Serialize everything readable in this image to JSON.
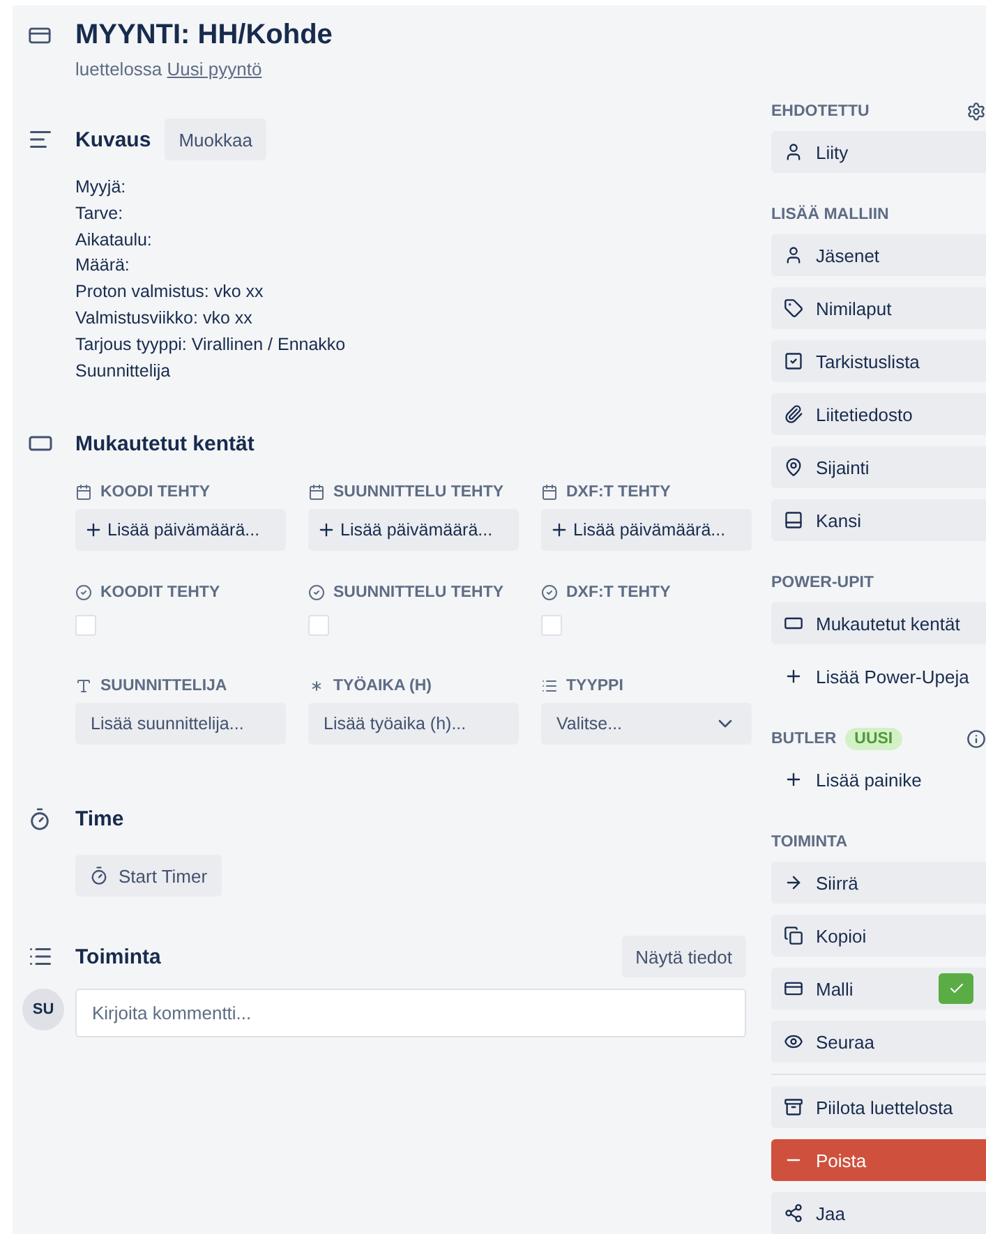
{
  "card": {
    "title": "MYYNTI: HH/Kohde",
    "list_prefix": "luettelossa",
    "list_link": "Uusi pyyntö"
  },
  "description": {
    "heading": "Kuvaus",
    "edit_button": "Muokkaa",
    "lines": [
      "Myyjä:",
      "Tarve:",
      "Aikataulu:",
      "Määrä:",
      "Proton valmistus: vko xx",
      "Valmistusviikko: vko xx",
      "Tarjous tyyppi: Virallinen / Ennakko",
      "Suunnittelija"
    ]
  },
  "custom_fields": {
    "heading": "Mukautetut kentät",
    "fields": [
      {
        "kind": "date",
        "label": "KOODI TEHTY",
        "action": "Lisää päivämäärä..."
      },
      {
        "kind": "date",
        "label": "SUUNNITTELU TEHTY",
        "action": "Lisää päivämäärä..."
      },
      {
        "kind": "date",
        "label": "DXF:T TEHTY",
        "action": "Lisää päivämäärä..."
      },
      {
        "kind": "checkbox",
        "label": "KOODIT TEHTY",
        "checked": false
      },
      {
        "kind": "checkbox",
        "label": "SUUNNITTELU TEHTY",
        "checked": false
      },
      {
        "kind": "checkbox",
        "label": "DXF:T TEHTY",
        "checked": false
      },
      {
        "kind": "text",
        "label": "SUUNNITTELIJA",
        "placeholder": "Lisää suunnittelija..."
      },
      {
        "kind": "number",
        "label": "TYÖAIKA (H)",
        "placeholder": "Lisää työaika (h)..."
      },
      {
        "kind": "dropdown",
        "label": "TYYPPI",
        "value": "Valitse..."
      }
    ]
  },
  "time": {
    "heading": "Time",
    "button": "Start Timer"
  },
  "activity": {
    "heading": "Toiminta",
    "details_button": "Näytä tiedot",
    "avatar": "SU",
    "comment_placeholder": "Kirjoita kommentti..."
  },
  "sidebar": {
    "sections": [
      {
        "title": "EHDOTETTU",
        "items": [
          {
            "kind": "button",
            "label": "Liity"
          }
        ]
      },
      {
        "title": "LISÄÄ MALLIIN",
        "items": [
          {
            "kind": "button",
            "label": "Jäsenet"
          },
          {
            "kind": "button",
            "label": "Nimilaput"
          },
          {
            "kind": "button",
            "label": "Tarkistuslista"
          },
          {
            "kind": "button",
            "label": "Liitetiedosto"
          },
          {
            "kind": "button",
            "label": "Sijainti"
          },
          {
            "kind": "button",
            "label": "Kansi"
          }
        ]
      },
      {
        "title": "POWER-UPIT",
        "items": [
          {
            "kind": "button",
            "label": "Mukautetut kentät"
          },
          {
            "kind": "link",
            "label": "Lisää Power-Upeja"
          }
        ]
      },
      {
        "title": "BUTLER",
        "badge": "UUSI",
        "items": [
          {
            "kind": "link",
            "label": "Lisää painike"
          }
        ]
      },
      {
        "title": "TOIMINTA",
        "items": [
          {
            "kind": "button",
            "label": "Siirrä"
          },
          {
            "kind": "button",
            "label": "Kopioi"
          },
          {
            "kind": "button",
            "label": "Malli",
            "checked": true
          },
          {
            "kind": "button",
            "label": "Seuraa"
          },
          {
            "kind": "button",
            "label": "Piilota luettelosta",
            "divider_before": true
          },
          {
            "kind": "danger",
            "label": "Poista"
          },
          {
            "kind": "button",
            "label": "Jaa"
          }
        ]
      }
    ]
  }
}
